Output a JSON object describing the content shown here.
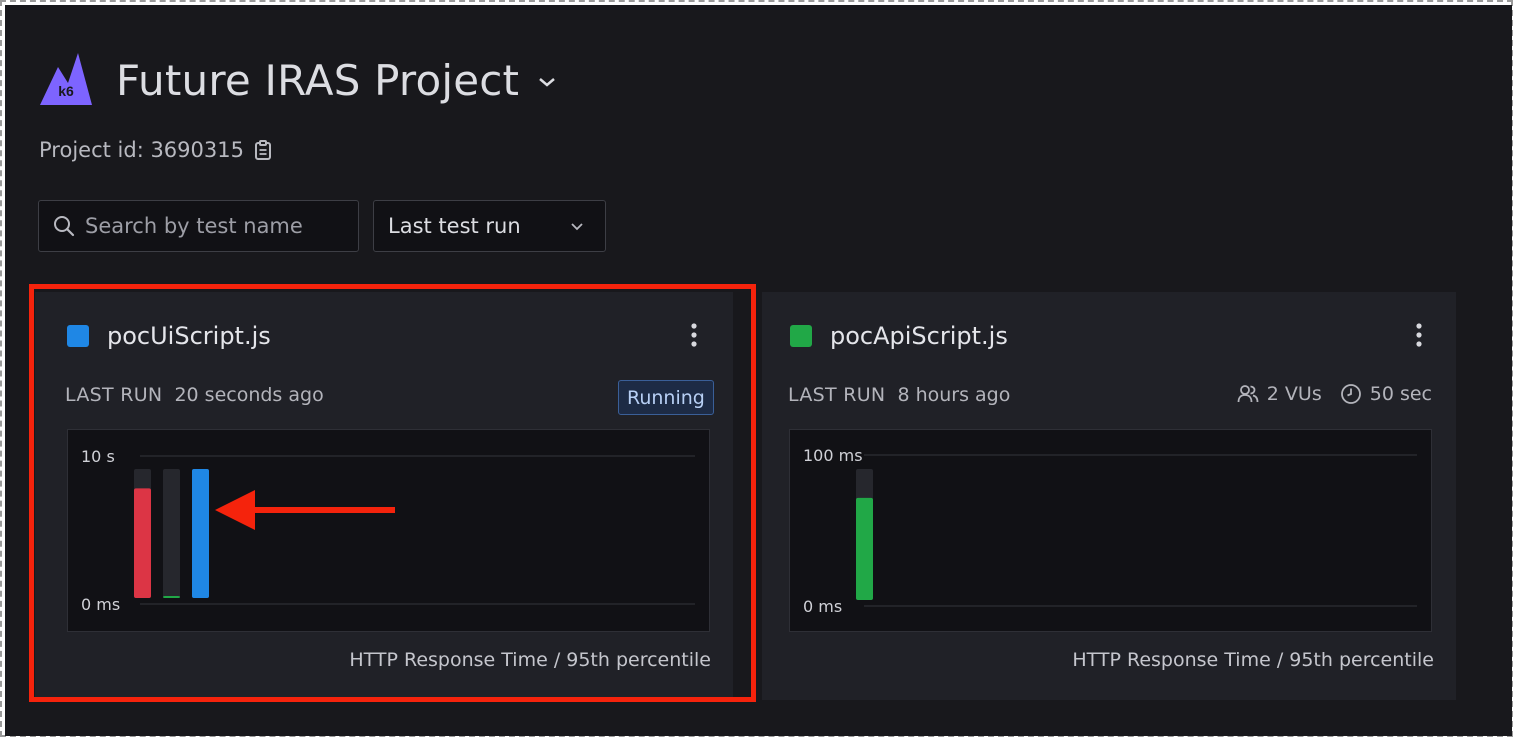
{
  "project": {
    "title": "Future IRAS Project",
    "id_text": "Project id: 3690315",
    "logo_text": "k6"
  },
  "filters": {
    "search_placeholder": "Search by test name",
    "sort_label": "Last test run"
  },
  "colors": {
    "accent": "#8a64f0",
    "highlight": "#f5230c",
    "blue": "#1f87e5",
    "green": "#21a847",
    "red": "#dc3545"
  },
  "cards": [
    {
      "name": "pocUiScript.js",
      "swatch_color": "#1f87e5",
      "last_run_label": "LAST RUN",
      "last_run_time": "20 seconds ago",
      "status": "Running",
      "caption": "HTTP Response Time / 95th percentile",
      "chart_data": {
        "type": "bar",
        "ylabel_top": "10 s",
        "ylabel_bottom": "0 ms",
        "ylim": [
          0,
          10
        ],
        "unit": "s",
        "bars": [
          {
            "value": 8.5,
            "color": "#dc3545"
          },
          {
            "value": 0.1,
            "color": "#21a847"
          },
          {
            "value": 10,
            "color": "#1f87e5"
          }
        ]
      }
    },
    {
      "name": "pocApiScript.js",
      "swatch_color": "#21a847",
      "last_run_label": "LAST RUN",
      "last_run_time": "8 hours ago",
      "vus": "2 VUs",
      "duration": "50 sec",
      "caption": "HTTP Response Time / 95th percentile",
      "chart_data": {
        "type": "bar",
        "ylabel_top": "100 ms",
        "ylabel_bottom": "0 ms",
        "ylim": [
          0,
          100
        ],
        "unit": "ms",
        "bars": [
          {
            "value": 78,
            "color": "#21a847"
          }
        ]
      }
    }
  ]
}
